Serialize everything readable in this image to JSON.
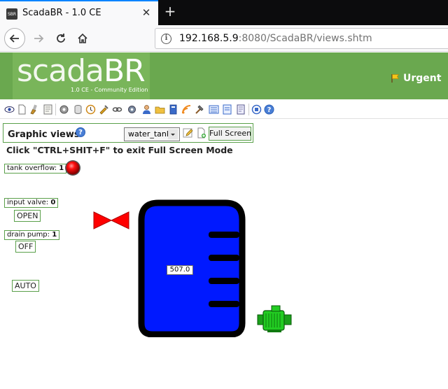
{
  "browser": {
    "tab_title": "ScadaBR - 1.0 CE",
    "tab_favicon_text": "SBR",
    "url_host": "192.168.5.9",
    "url_rest": ":8080/ScadaBR/views.shtm"
  },
  "header": {
    "logo_part1": "scada",
    "logo_part2": "BR",
    "logo_subtitle": "1.0 CE - Community Edition",
    "urgent_label": "Urgent"
  },
  "toolbar": {
    "icons": [
      "watchlist-icon",
      "page-icon",
      "brush-icon",
      "report-icon",
      "gear-icon",
      "datasource-icon",
      "clock-icon",
      "tools-icon",
      "link-icon",
      "folder-icon",
      "user-icon",
      "folders-icon",
      "book-icon",
      "rss-icon",
      "hammer-icon",
      "list-icon",
      "doc-icon",
      "scroll-icon",
      "stop-icon",
      "help-icon"
    ]
  },
  "view": {
    "title": "Graphic views",
    "selected_view": "water_tank",
    "fullscreen_label": "Full Screen",
    "exit_message": "Click \"CTRL+SHIT+F\" to exit Full Screen Mode"
  },
  "points": {
    "tank_overflow_label": "tank overflow:",
    "tank_overflow_value": "1",
    "input_valve_label": "input valve:",
    "input_valve_value": "0",
    "input_valve_button": "OPEN",
    "drain_pump_label": "drain pump:",
    "drain_pump_value": "1",
    "drain_pump_button": "OFF",
    "auto_button": "AUTO",
    "tank_level_value": "507.0"
  },
  "colors": {
    "header_green": "#6aa84f",
    "tank_blue": "#0019ff",
    "valve_red": "#ff0000",
    "pump_green": "#22cc22",
    "led_red": "#e00000"
  }
}
